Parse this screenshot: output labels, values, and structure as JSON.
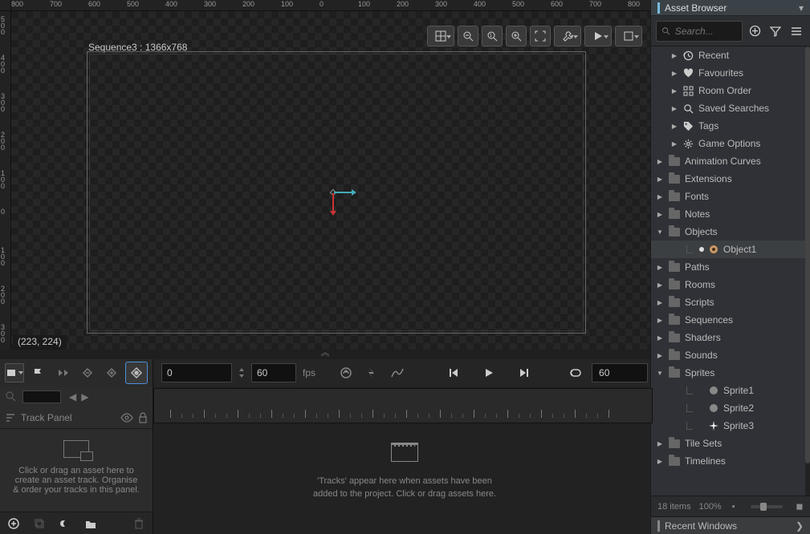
{
  "sequence": {
    "label": "Sequence3 : 1366x768"
  },
  "canvas": {
    "coords": "(223, 224)"
  },
  "ruler_top": [
    "800",
    "700",
    "600",
    "500",
    "400",
    "300",
    "200",
    "100",
    "0",
    "100",
    "200",
    "300",
    "400",
    "500",
    "600",
    "700",
    "800"
  ],
  "ruler_left": [
    "500",
    "400",
    "300",
    "200",
    "100",
    "0",
    "100",
    "200",
    "300"
  ],
  "timeline": {
    "frame": "0",
    "fps_value": "60",
    "fps_label": "fps",
    "length": "60"
  },
  "track_panel": {
    "title": "Track Panel",
    "hint": "Click or drag an asset here to create an asset track. Organise & order your tracks in this panel."
  },
  "timeline_drop": {
    "line1": "'Tracks' appear here when assets have been",
    "line2": "added to the project. Click or drag assets here."
  },
  "asset_browser": {
    "title": "Asset Browser",
    "search_placeholder": "Search...",
    "quick": [
      "Recent",
      "Favourites",
      "Room Order",
      "Saved Searches",
      "Tags",
      "Game Options"
    ],
    "folders": [
      {
        "name": "Animation Curves",
        "open": false
      },
      {
        "name": "Extensions",
        "open": false
      },
      {
        "name": "Fonts",
        "open": false
      },
      {
        "name": "Notes",
        "open": false
      },
      {
        "name": "Objects",
        "open": true,
        "children": [
          {
            "name": "Object1",
            "icon": "object",
            "selected": true
          }
        ]
      },
      {
        "name": "Paths",
        "open": false
      },
      {
        "name": "Rooms",
        "open": false
      },
      {
        "name": "Scripts",
        "open": false
      },
      {
        "name": "Sequences",
        "open": false
      },
      {
        "name": "Shaders",
        "open": false
      },
      {
        "name": "Sounds",
        "open": false
      },
      {
        "name": "Sprites",
        "open": true,
        "children": [
          {
            "name": "Sprite1",
            "icon": "sprite"
          },
          {
            "name": "Sprite2",
            "icon": "sprite"
          },
          {
            "name": "Sprite3",
            "icon": "sparkle"
          }
        ]
      },
      {
        "name": "Tile Sets",
        "open": false
      },
      {
        "name": "Timelines",
        "open": false
      }
    ],
    "footer_items": "18 items",
    "footer_zoom": "100%",
    "recent_title": "Recent Windows"
  }
}
